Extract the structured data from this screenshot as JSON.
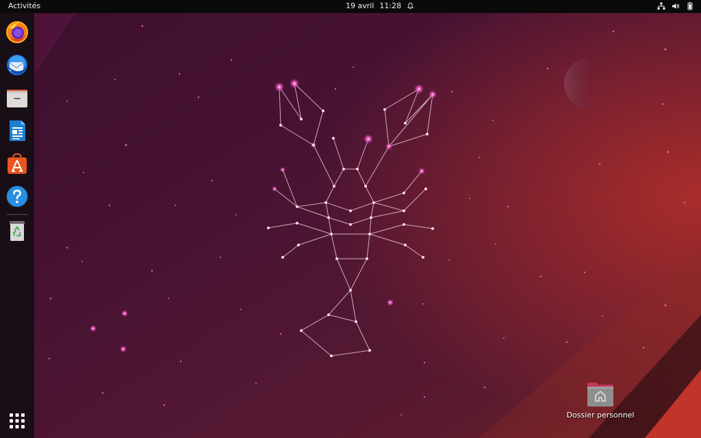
{
  "topbar": {
    "activities_label": "Activités",
    "date": "19 avril",
    "time": "11:28",
    "icons": [
      "notification-bell-icon",
      "network-icon",
      "volume-icon",
      "battery-icon"
    ]
  },
  "dock": {
    "apps": [
      {
        "name": "Firefox",
        "icon": "firefox-icon"
      },
      {
        "name": "Thunderbird",
        "icon": "thunderbird-icon"
      },
      {
        "name": "Fichiers",
        "icon": "files-icon"
      },
      {
        "name": "LibreOffice Writer",
        "icon": "libreoffice-writer-icon"
      },
      {
        "name": "Ubuntu Software",
        "icon": "ubuntu-software-icon"
      },
      {
        "name": "Aide",
        "icon": "help-icon"
      },
      {
        "name": "Corbeille",
        "icon": "trash-icon"
      }
    ],
    "show_apps_icon": "apps-grid-icon"
  },
  "desktop": {
    "home_folder_label": "Dossier personnel",
    "home_folder_icon": "home-folder-icon"
  },
  "colors": {
    "topbar": "#0a0a0a",
    "dock": "#160e14",
    "wallpaper_base": "#3a0f2c",
    "accent_orange": "#e95420",
    "star_pink": "#ff4fc8"
  }
}
